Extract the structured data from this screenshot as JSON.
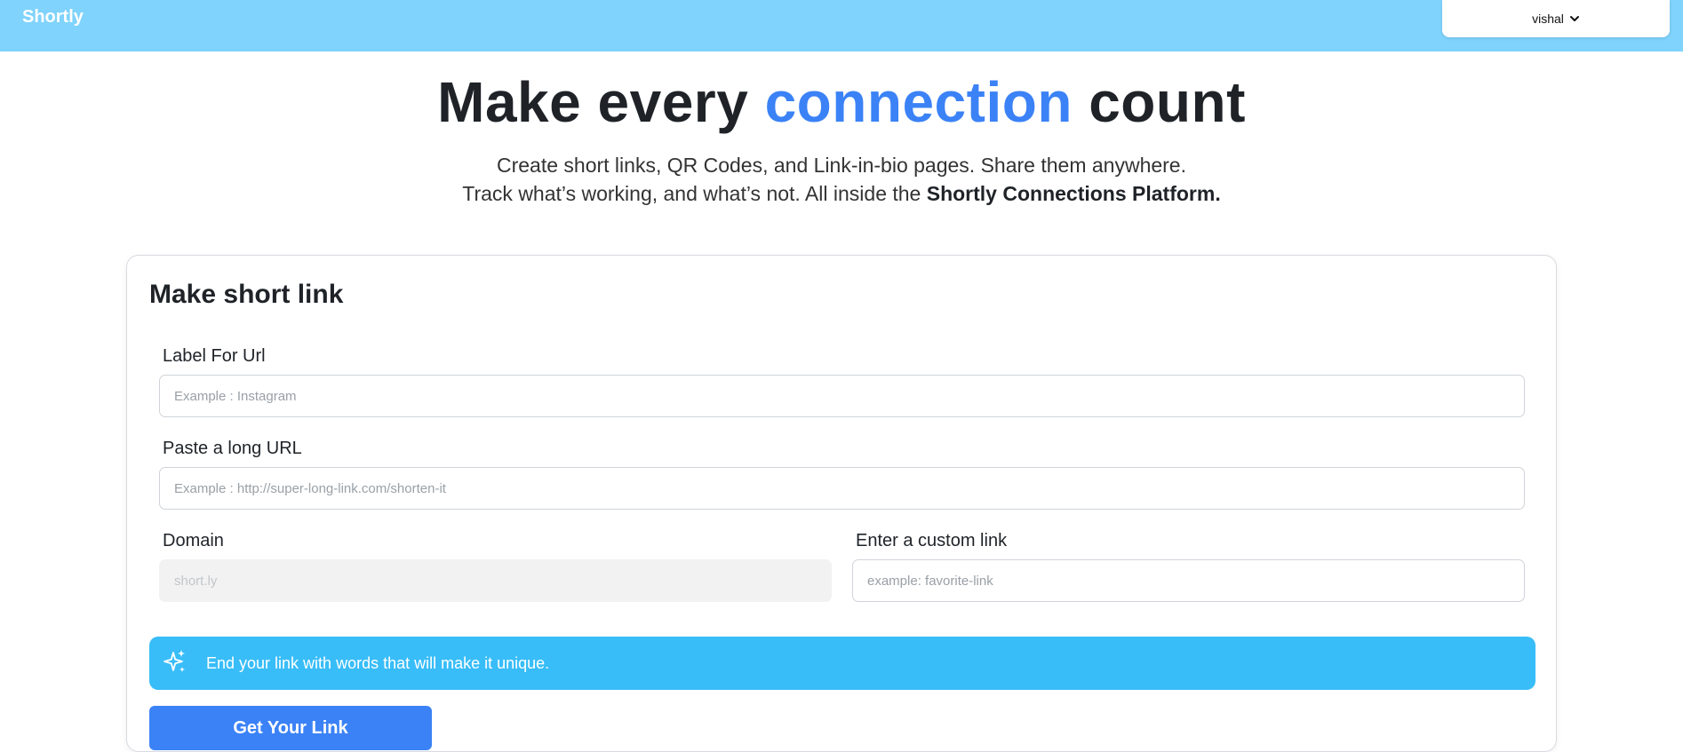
{
  "navbar": {
    "brand": "Shortly",
    "user_name": "vishal",
    "user_chevron_icon": "chevron-down-icon",
    "background": "#7fd3fc"
  },
  "hero": {
    "title_before": "Make every ",
    "title_accent": "connection",
    "title_after": " count",
    "accent_color": "#3b82f6",
    "subtitle_line1": "Create short links, QR Codes, and Link-in-bio pages. Share them anywhere.",
    "subtitle_line2_prefix": "Track what’s working, and what’s not. All inside the ",
    "subtitle_line2_bold": "Shortly Connections Platform."
  },
  "form": {
    "title": "Make short link",
    "label_field": {
      "label": "Label For Url",
      "placeholder": "Example : Instagram",
      "value": ""
    },
    "url_field": {
      "label": "Paste a long URL",
      "placeholder": "Example : http://super-long-link.com/shorten-it",
      "value": ""
    },
    "domain_field": {
      "label": "Domain",
      "placeholder": "short.ly",
      "disabled": true
    },
    "custom_field": {
      "label": "Enter a custom link",
      "placeholder": "example: favorite-link",
      "value": ""
    },
    "tip": {
      "icon": "sparkles-icon",
      "text": "End your link with words that will make it unique.",
      "color": "#38bdf8"
    },
    "submit_label": "Get Your Link",
    "submit_color": "#3b82f6"
  }
}
